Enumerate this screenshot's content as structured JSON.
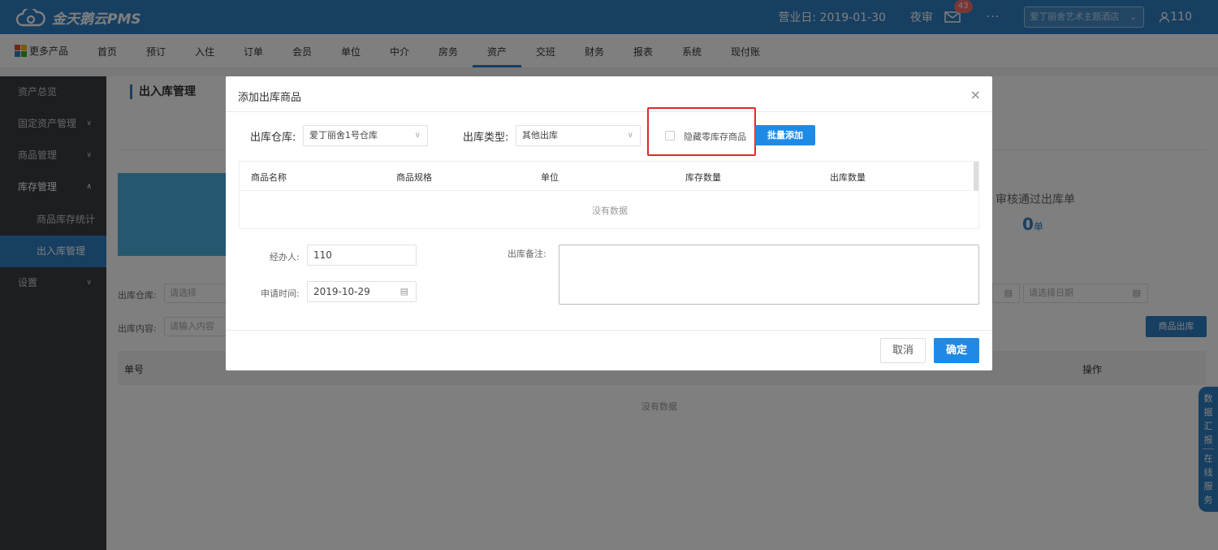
{
  "topbar": {
    "app_name": "金天鹅云PMS",
    "business_day": "营业日: 2019-01-30",
    "night_audit": "夜审",
    "mail_badge": "43",
    "more": "···",
    "hotel_select": "爱丁丽舍艺术主题酒店",
    "user": "110",
    "colors": {
      "brand": "#2f7fc3",
      "badge": "#f56c6c"
    }
  },
  "nav": {
    "more_products": "更多产品",
    "items": [
      "首页",
      "预订",
      "入住",
      "订单",
      "会员",
      "单位",
      "中介",
      "房务",
      "资产",
      "交班",
      "财务",
      "报表",
      "系统",
      "现付账"
    ],
    "active": "资产"
  },
  "sidebar": {
    "items": [
      {
        "label": "资产总览"
      },
      {
        "label": "固定资产管理"
      },
      {
        "label": "商品管理"
      },
      {
        "label": "库存管理"
      },
      {
        "label": "商品库存统计"
      },
      {
        "label": "出入库管理"
      },
      {
        "label": "设置"
      }
    ]
  },
  "page": {
    "title": "出入库管理",
    "stat_label": "审核通过出库单",
    "stat_value": "0",
    "stat_unit": "单",
    "filter_warehouse_label": "出库仓库:",
    "filter_warehouse_placeholder": "请选择",
    "filter_content_label": "出库内容:",
    "filter_content_placeholder": "请输入内容",
    "date_placeholder": "请选择日期",
    "outbound_button": "商品出库",
    "list_headers": [
      "单号",
      "操作"
    ],
    "list_empty": "没有数据"
  },
  "float_panel": {
    "data_summary": [
      "数",
      "据",
      "汇",
      "报"
    ],
    "online_service": [
      "在",
      "线",
      "服",
      "务"
    ]
  },
  "modal": {
    "title": "添加出库商品",
    "close": "×",
    "warehouse_label": "出库仓库:",
    "warehouse_value": "爱丁丽舍1号仓库",
    "type_label": "出库类型:",
    "type_value": "其他出库",
    "hide_zero_stock": "隐藏零库存商品",
    "batch_add": "批量添加",
    "table_headers": [
      "商品名称",
      "商品规格",
      "单位",
      "库存数量",
      "出库数量"
    ],
    "table_empty": "没有数据",
    "handler_label": "经办人:",
    "handler_value": "110",
    "apply_time_label": "申请时间:",
    "apply_time_value": "2019-10-29",
    "remark_label": "出库备注:",
    "cancel": "取消",
    "confirm": "确定",
    "highlight_color": "#e5262b"
  }
}
